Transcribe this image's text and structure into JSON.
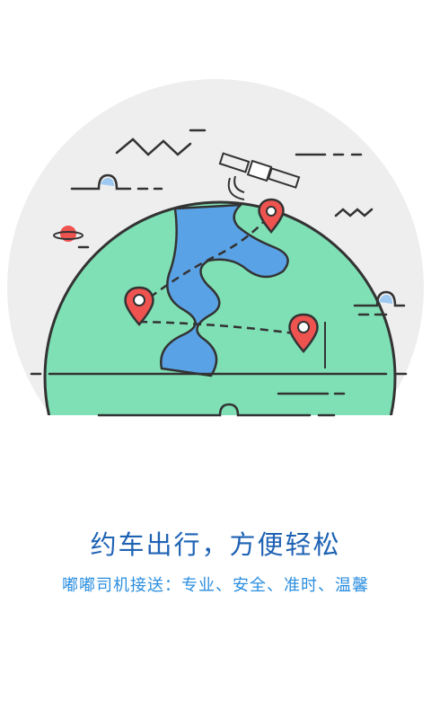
{
  "splash": {
    "title": "约车出行，方便轻松",
    "subtitle": "嘟嘟司机接送：专业、安全、准时、温馨"
  },
  "illustration": {
    "land_color": "#7fe0b5",
    "river_color": "#5aa2e6",
    "pin_color": "#ef5350",
    "backdrop_color": "#eeeeee"
  }
}
